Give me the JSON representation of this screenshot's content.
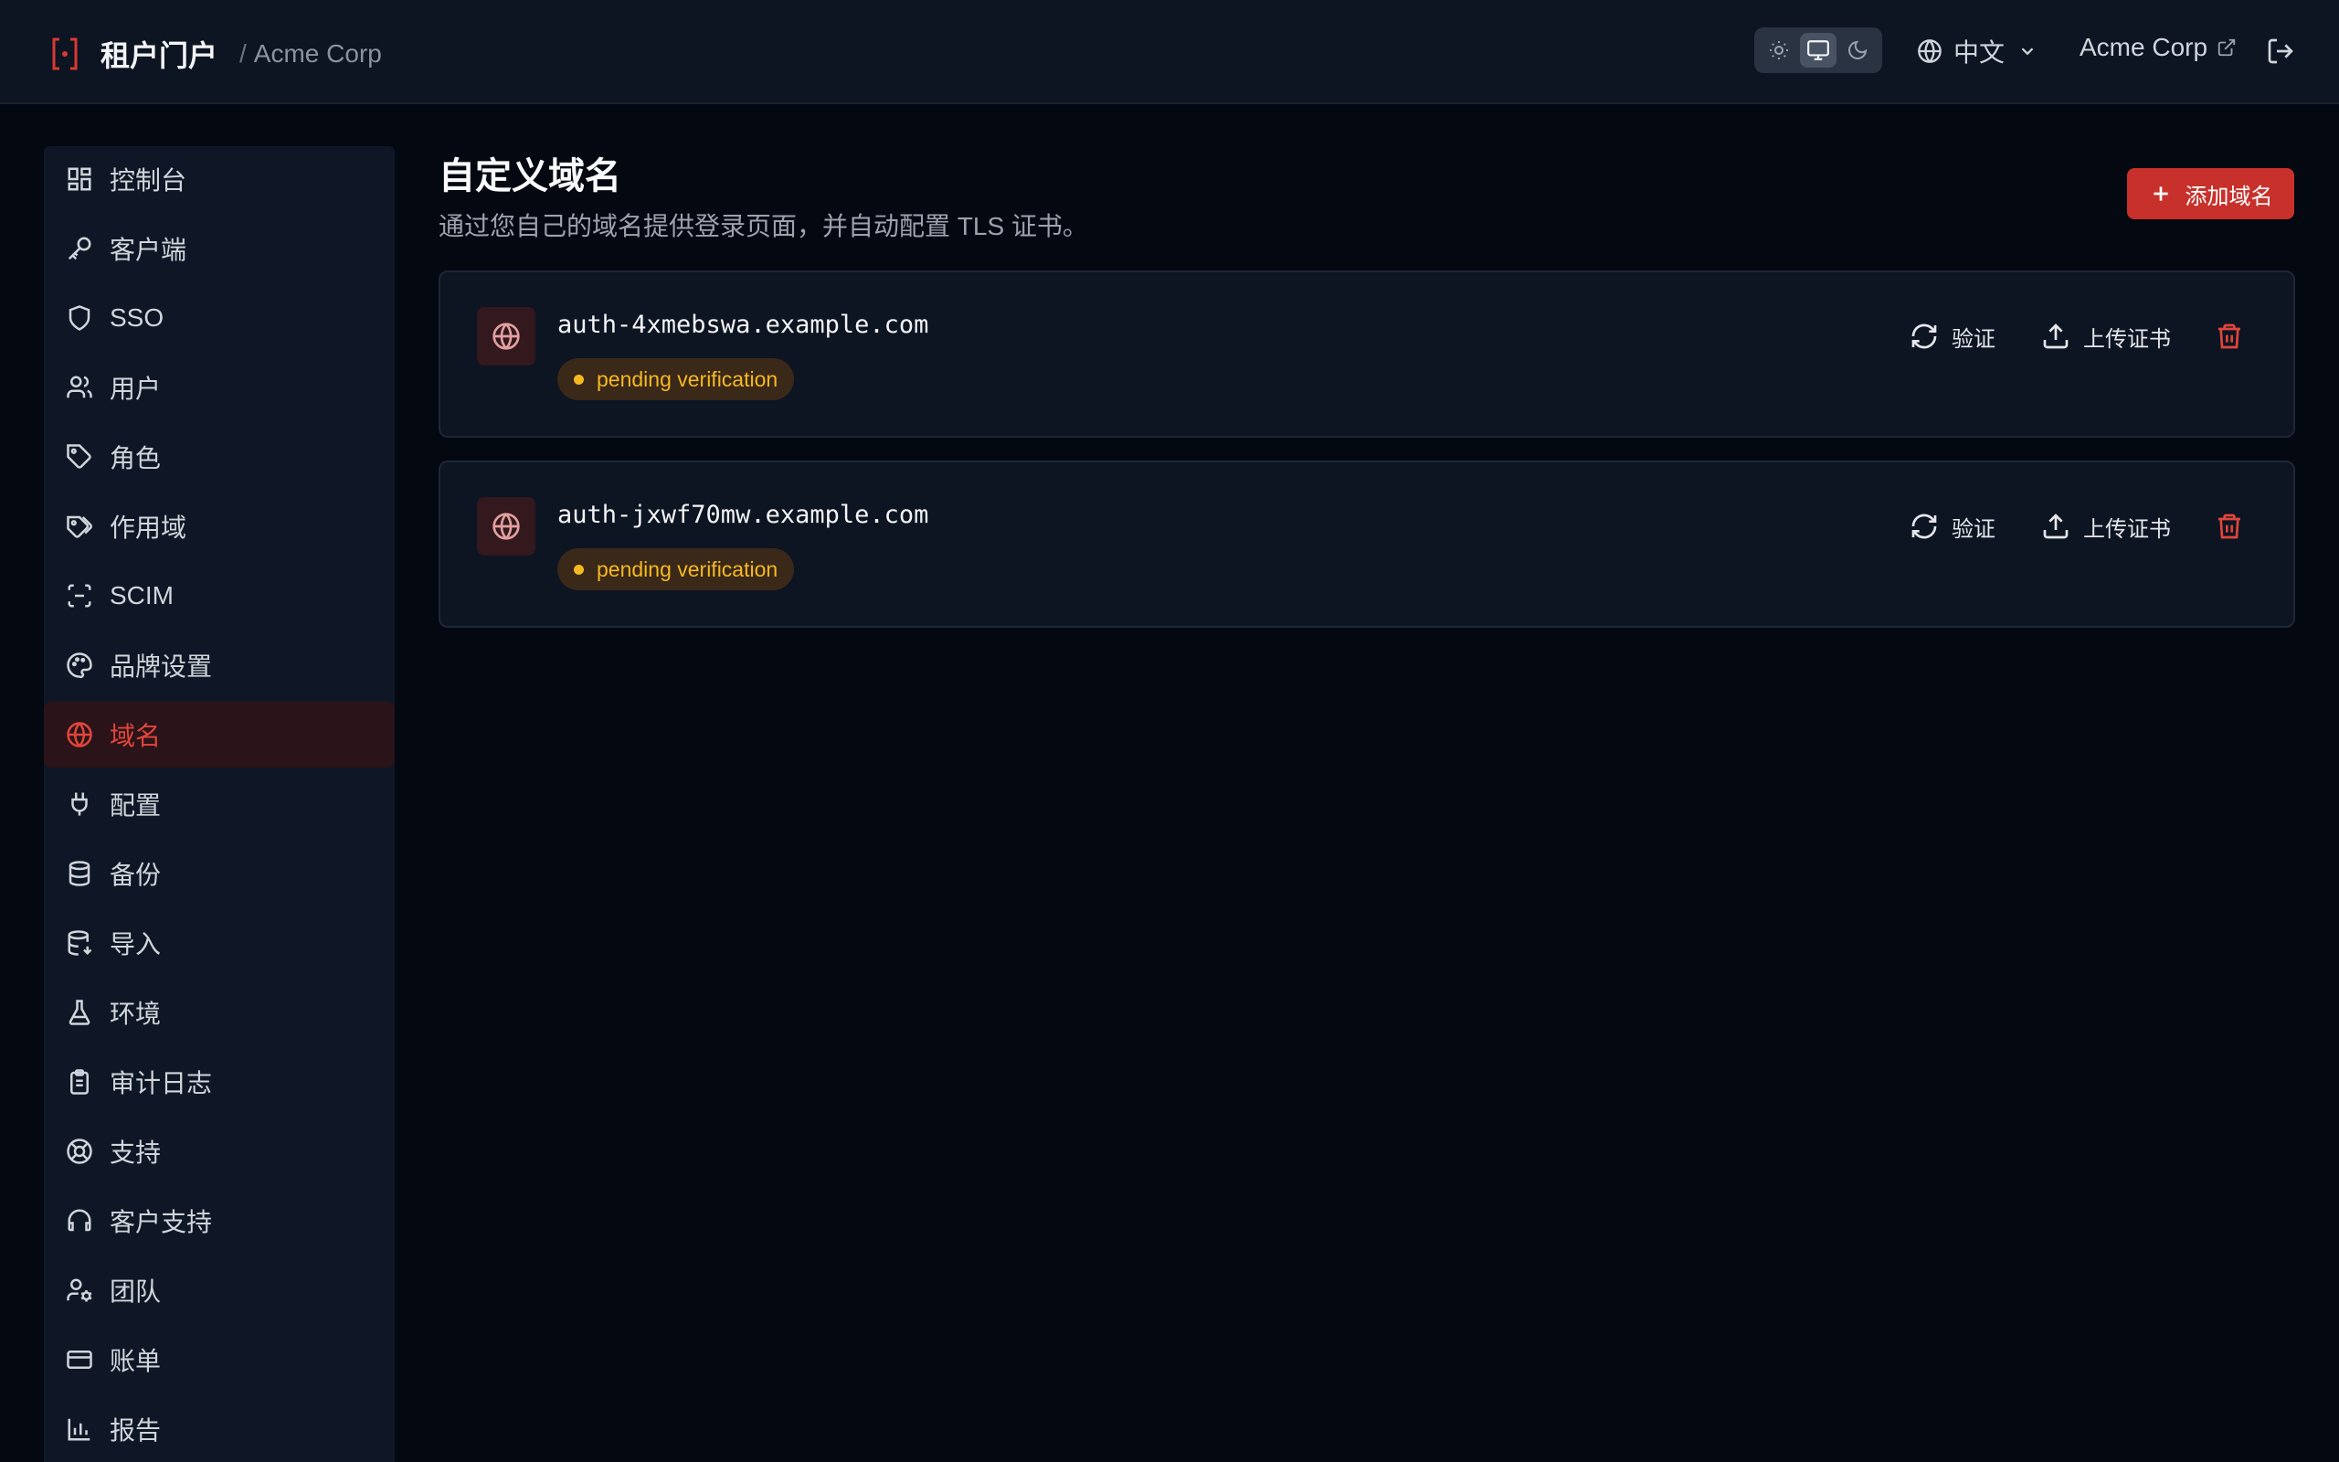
{
  "header": {
    "title": "租户门户",
    "separator": "/",
    "tenant": "Acme Corp",
    "language": "中文",
    "org_link": "Acme Corp",
    "theme_options": [
      "light-icon",
      "system-icon",
      "dark-icon"
    ],
    "theme_active": "system"
  },
  "sidebar": {
    "items": [
      {
        "label": "控制台",
        "icon": "dashboard-icon"
      },
      {
        "label": "客户端",
        "icon": "key-icon"
      },
      {
        "label": "SSO",
        "icon": "shield-icon"
      },
      {
        "label": "用户",
        "icon": "users-icon"
      },
      {
        "label": "角色",
        "icon": "tag-icon"
      },
      {
        "label": "作用域",
        "icon": "tags-icon"
      },
      {
        "label": "SCIM",
        "icon": "scan-icon"
      },
      {
        "label": "品牌设置",
        "icon": "palette-icon"
      },
      {
        "label": "域名",
        "icon": "globe-icon",
        "active": true
      },
      {
        "label": "配置",
        "icon": "plug-icon"
      },
      {
        "label": "备份",
        "icon": "database-icon"
      },
      {
        "label": "导入",
        "icon": "database-import-icon"
      },
      {
        "label": "环境",
        "icon": "flask-icon"
      },
      {
        "label": "审计日志",
        "icon": "clipboard-icon"
      },
      {
        "label": "支持",
        "icon": "lifebuoy-icon"
      },
      {
        "label": "客户支持",
        "icon": "headset-icon"
      },
      {
        "label": "团队",
        "icon": "user-cog-icon"
      },
      {
        "label": "账单",
        "icon": "credit-card-icon"
      },
      {
        "label": "报告",
        "icon": "bar-chart-icon"
      }
    ]
  },
  "main": {
    "title": "自定义域名",
    "subtitle": "通过您自己的域名提供登录页面，并自动配置 TLS 证书。",
    "add_button": "添加域名",
    "domains": [
      {
        "name": "auth-4xmebswa.example.com",
        "status": "pending verification",
        "verify_label": "验证",
        "upload_label": "上传证书"
      },
      {
        "name": "auth-jxwf70mw.example.com",
        "status": "pending verification",
        "verify_label": "验证",
        "upload_label": "上传证书"
      }
    ]
  },
  "colors": {
    "accent": "#c8312b",
    "active_nav": "#e2453b",
    "pending": "#f5b922",
    "background": "#040811",
    "panel": "#0f1726"
  }
}
